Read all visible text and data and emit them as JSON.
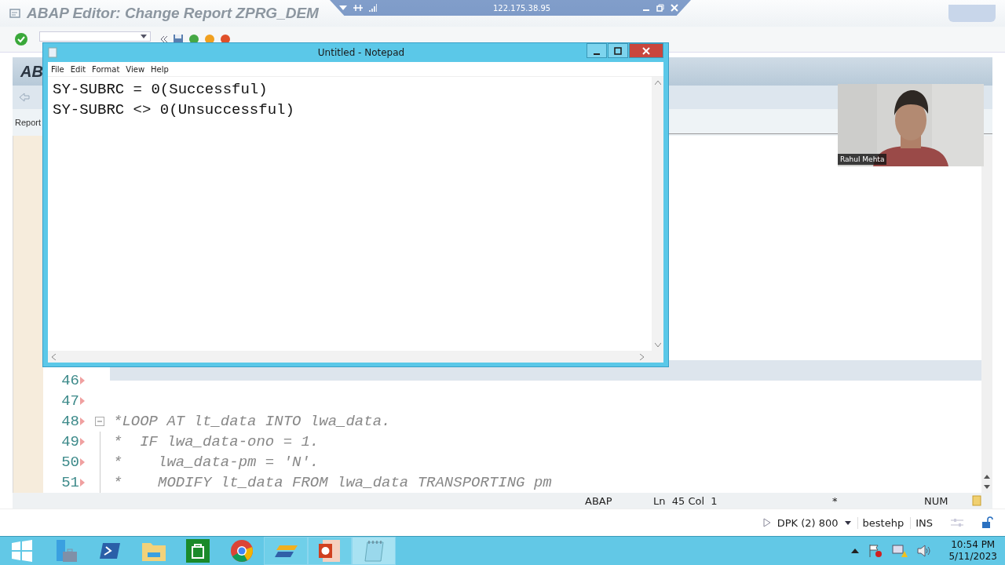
{
  "remote_bar": {
    "address": "122.175.38.95"
  },
  "sap_window": {
    "title": "ABAP Editor: Change Report ZPRG_DEM",
    "header": "AB",
    "section_label": "Report",
    "editor": {
      "lines": [
        {
          "number": "46",
          "fold": false,
          "guide": false
        },
        {
          "number": "47",
          "fold": false,
          "guide": false
        },
        {
          "number": "48",
          "text": "*LOOP AT lt_data INTO lwa_data.",
          "fold": true,
          "guide": false
        },
        {
          "number": "49",
          "text": "*  IF lwa_data-ono = 1.",
          "fold": false,
          "guide": true
        },
        {
          "number": "50",
          "text": "*    lwa_data-pm = 'N'.",
          "fold": false,
          "guide": true
        },
        {
          "number": "51",
          "text": "*    MODIFY lt_data FROM lwa_data TRANSPORTING pm",
          "fold": false,
          "guide": true
        }
      ]
    },
    "editor_status": {
      "language": "ABAP",
      "position": "Ln  45 Col  1",
      "modified": "*",
      "mode": "NUM"
    },
    "status_bar": {
      "system": "DPK (2) 800",
      "user": "bestehp",
      "mode": "INS"
    }
  },
  "notepad": {
    "title": "Untitled - Notepad",
    "menu": [
      "File",
      "Edit",
      "Format",
      "View",
      "Help"
    ],
    "lines": [
      "SY-SUBRC = 0(Successful)",
      "SY-SUBRC <> 0(Unsuccessful)"
    ]
  },
  "webcam": {
    "kind": "picture",
    "name": "Rahul Mehta"
  },
  "taskbar": {
    "apps": [
      {
        "kind": "start",
        "running": false,
        "active": false
      },
      {
        "kind": "server",
        "running": false,
        "active": false
      },
      {
        "kind": "shell",
        "running": false,
        "active": false
      },
      {
        "kind": "folder",
        "running": false,
        "active": false
      },
      {
        "kind": "store",
        "running": false,
        "active": false
      },
      {
        "kind": "browser",
        "running": false,
        "active": false
      },
      {
        "kind": "sap",
        "running": true,
        "active": false
      },
      {
        "kind": "slides",
        "running": true,
        "active": false
      },
      {
        "kind": "notepad",
        "running": true,
        "active": true
      }
    ],
    "time": "10:54 PM",
    "date": "5/11/2023"
  }
}
